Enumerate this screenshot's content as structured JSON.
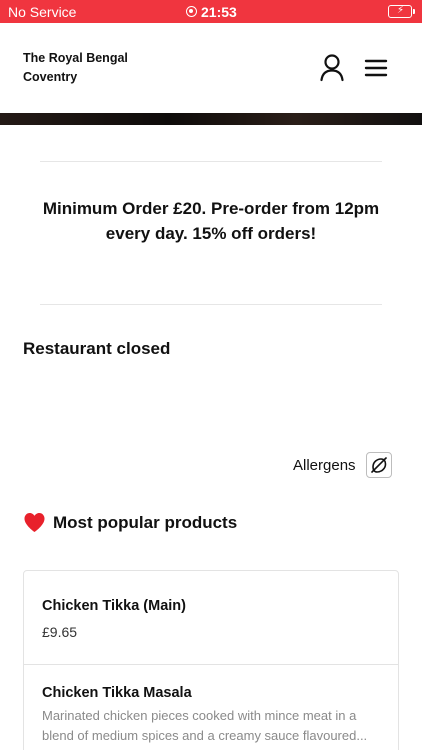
{
  "status_bar": {
    "carrier": "No Service",
    "time": "21:53",
    "battery_icon": "battery-charging-icon",
    "battery_color": "#4cd964",
    "bar_color": "#f0353f"
  },
  "header": {
    "brand_line1": "The Royal Bengal",
    "brand_line2": "Coventry",
    "account_icon": "user-icon",
    "menu_icon": "hamburger-menu-icon"
  },
  "notice": {
    "text": "Minimum Order £20. Pre-order from 12pm every day. 15% off orders!"
  },
  "restaurant_status": "Restaurant closed",
  "allergens": {
    "label": "Allergens",
    "icon": "allergens-icon"
  },
  "popular": {
    "icon": "heart-icon",
    "title": "Most popular products"
  },
  "products": [
    {
      "name": "Chicken Tikka (Main)",
      "price": "£9.65"
    },
    {
      "name": "Chicken Tikka Masala",
      "desc_line1": "Marinated chicken pieces cooked with mince meat in a",
      "desc_line2": "blend of medium spices and a creamy sauce flavoured..."
    }
  ]
}
